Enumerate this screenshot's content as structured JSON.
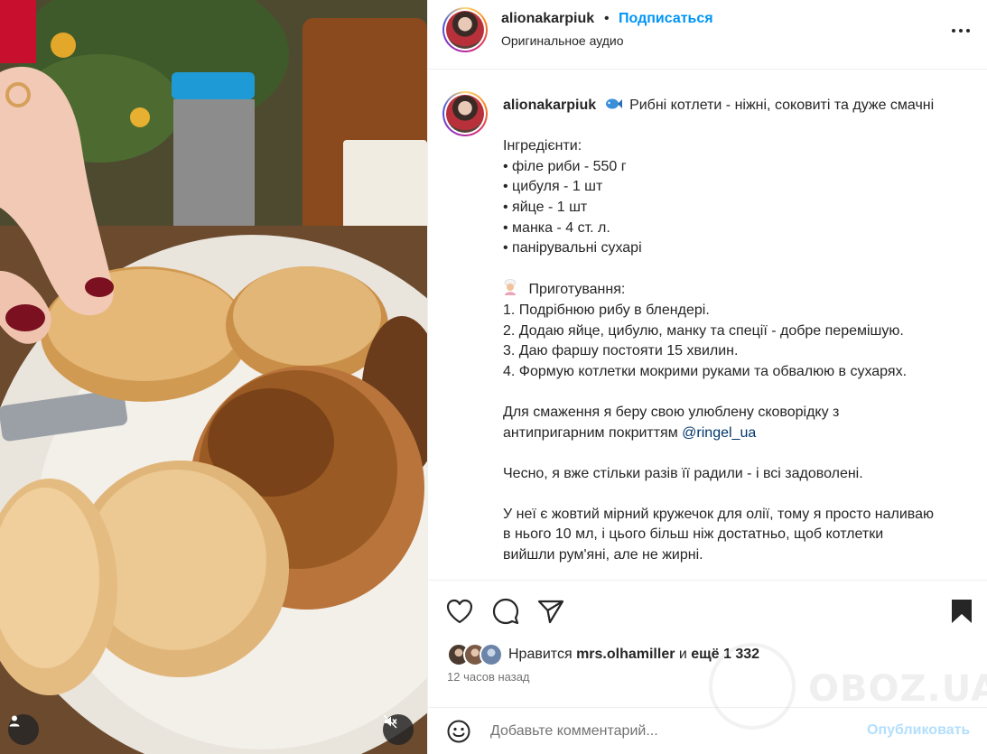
{
  "header": {
    "username": "alionakarpiuk",
    "separator": "•",
    "follow_label": "Подписаться",
    "audio_label": "Оригинальное аудио"
  },
  "caption": {
    "username": "alionakarpiuk",
    "title": "Рибні котлети - ніжні, соковиті та дуже смачні",
    "ingredients_header": "Інгредієнти:",
    "ingredients": [
      "• філе риби - 550 г",
      "• цибуля - 1 шт",
      "• яйце - 1 шт",
      "• манка - 4 ст. л.",
      "• панірувальні сухарі"
    ],
    "steps_header": "Приготування:",
    "steps": [
      "1. Подрібнюю рибу в блендері.",
      "2. Додаю яйце, цибулю, манку та спеції - добре перемішую.",
      "3. Даю фаршу постояти 15 хвилин.",
      "4. Формую котлетки мокрими руками та обвалюю в сухарях."
    ],
    "pan_line1": "Для смаження я беру свою улюблену сковорідку з",
    "pan_line2_prefix": "антипригарним покриттям",
    "pan_mention": "@ringel_ua",
    "honest_line": "Чесно, я вже стільки разів її радили - і всі задоволені.",
    "oil_lines": [
      "У неї є жовтий мірний кружечок для олії, тому я просто наливаю",
      "в нього 10 мл, і цього більш ніж достатньо, щоб котлетки",
      "вийшли рум'яні, але не жирні."
    ]
  },
  "likes": {
    "prefix": "Нравится",
    "user": "mrs.olhamiller",
    "conjunction": "и",
    "count": "ещё 1 332"
  },
  "timestamp": "12 часов назад",
  "comment": {
    "placeholder": "Добавьте комментарий...",
    "post_label": "Опубликовать"
  },
  "watermark": {
    "text": "OBOZ.UA"
  },
  "colors": {
    "accent": "#0095f6",
    "link": "#00376b",
    "muted": "#737373",
    "post_disabled": "#b2dffc"
  }
}
